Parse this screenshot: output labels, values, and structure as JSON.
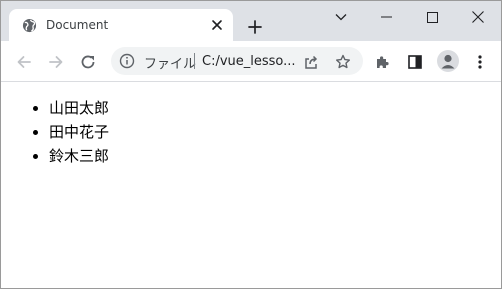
{
  "browser": {
    "tab": {
      "title": "Document"
    },
    "omnibox": {
      "scheme_chip": "ファイル",
      "url": "C:/vue_lesso..."
    },
    "icons": {
      "favicon": "globe-icon",
      "tab_close": "close-icon",
      "new_tab": "plus-icon",
      "tab_search": "chevron-down-icon",
      "minimize": "minimize-icon",
      "maximize": "maximize-icon",
      "close_window": "close-icon",
      "back": "arrow-left-icon",
      "forward": "arrow-right-icon",
      "reload": "reload-icon",
      "site_info": "info-icon",
      "share": "share-icon",
      "bookmark": "star-icon",
      "extensions": "puzzle-icon",
      "side_panel": "side-panel-icon",
      "profile": "person-icon",
      "menu": "kebab-menu-icon"
    },
    "colors": {
      "tabstrip": "#dee1e6",
      "omnibox": "#f1f3f4",
      "icon": "#5f6368",
      "icon_disabled": "#c0c3c7"
    }
  },
  "page": {
    "list": [
      {
        "label": "山田太郎"
      },
      {
        "label": "田中花子"
      },
      {
        "label": "鈴木三郎"
      }
    ]
  }
}
